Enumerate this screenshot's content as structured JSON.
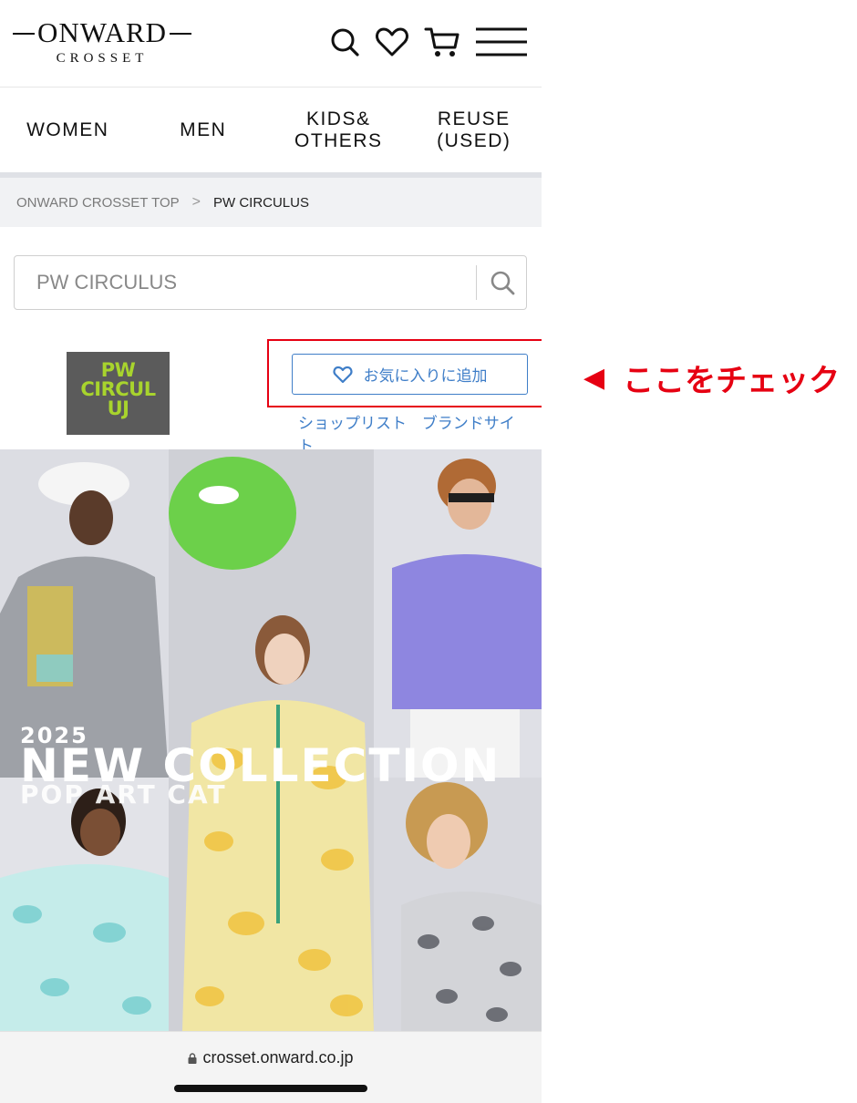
{
  "header": {
    "logo_main": "ONWARD",
    "logo_sub": "CROSSET",
    "icons": [
      "search-icon",
      "heart-icon",
      "cart-icon",
      "menu-icon"
    ]
  },
  "categories": [
    {
      "label": "WOMEN"
    },
    {
      "label": "MEN"
    },
    {
      "label": "KIDS&\nOTHERS"
    },
    {
      "label": "REUSE\n(USED)"
    }
  ],
  "breadcrumb": {
    "top": "ONWARD CROSSET TOP",
    "separator": ">",
    "current": "PW CIRCULUS"
  },
  "search": {
    "placeholder": "PW CIRCULUS"
  },
  "brand": {
    "logo_text": "PW\nCIRCUL\nUJ",
    "logo_bg": "#5b5b5b",
    "logo_fg": "#a8d42d",
    "favorite_label": "お気に入りに追加",
    "links": [
      "ショップリスト",
      "ブランドサイト"
    ],
    "accent": "#3f7ec8"
  },
  "annotation": {
    "arrow": "◀",
    "text": "ここをチェック",
    "color": "#e60012"
  },
  "hero": {
    "year": "2025",
    "title": "NEW COLLECTION",
    "subtitle": "POP ART CAT"
  },
  "browser": {
    "url": "crosset.onward.co.jp"
  }
}
